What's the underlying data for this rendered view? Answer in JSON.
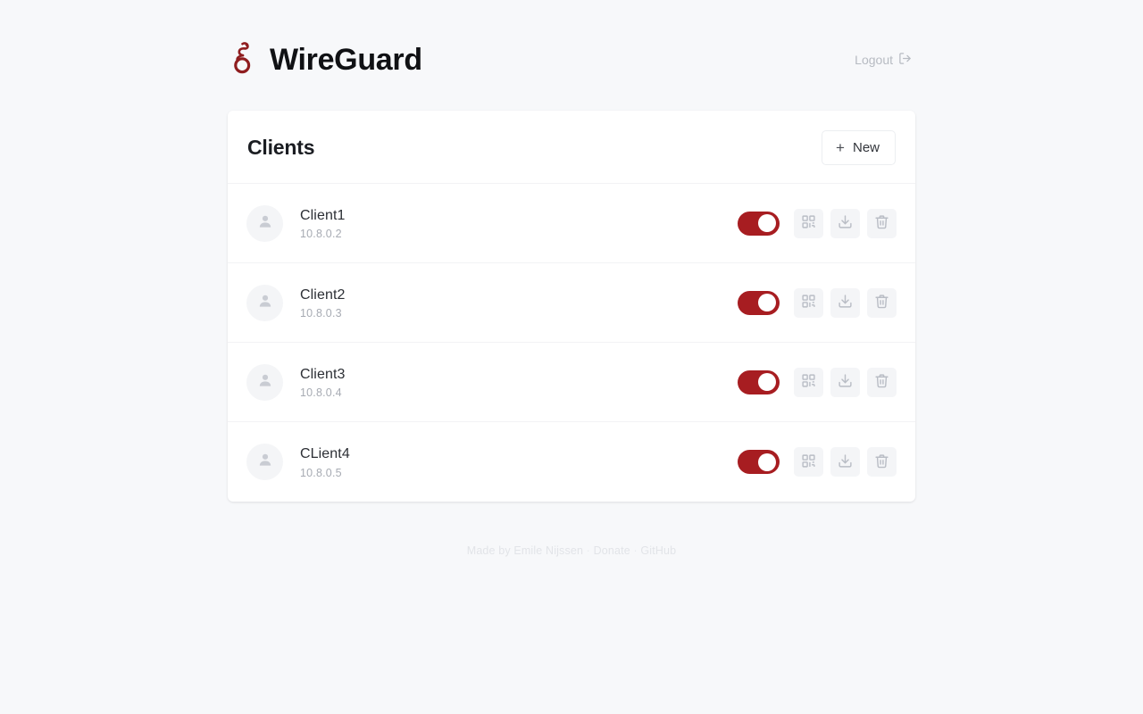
{
  "header": {
    "brand_title": "WireGuard",
    "logo_icon": "wireguard-dragon-logo",
    "logout_label": "Logout",
    "logout_icon": "logout-arrow-icon"
  },
  "card": {
    "title": "Clients",
    "new_button_label": "New",
    "new_button_plus": "+"
  },
  "clients": [
    {
      "name": "Client1",
      "ip": "10.8.0.2",
      "enabled": true,
      "avatar_icon": "user-avatar-icon",
      "qr_icon": "qr-code-icon",
      "download_icon": "download-icon",
      "delete_icon": "trash-icon"
    },
    {
      "name": "Client2",
      "ip": "10.8.0.3",
      "enabled": true,
      "avatar_icon": "user-avatar-icon",
      "qr_icon": "qr-code-icon",
      "download_icon": "download-icon",
      "delete_icon": "trash-icon"
    },
    {
      "name": "Client3",
      "ip": "10.8.0.4",
      "enabled": true,
      "avatar_icon": "user-avatar-icon",
      "qr_icon": "qr-code-icon",
      "download_icon": "download-icon",
      "delete_icon": "trash-icon"
    },
    {
      "name": "CLient4",
      "ip": "10.8.0.5",
      "enabled": true,
      "avatar_icon": "user-avatar-icon",
      "qr_icon": "qr-code-icon",
      "download_icon": "download-icon",
      "delete_icon": "trash-icon"
    }
  ],
  "footer": {
    "made_by": "Made by Emile Nijssen",
    "separator_1": "·",
    "donate": "Donate",
    "separator_2": "·",
    "github": "GitHub"
  },
  "colors": {
    "page_background": "#f7f8fa",
    "card_background": "#ffffff",
    "accent_red": "#a71d21",
    "title_text": "#1b1d22",
    "muted_text": "#a7abb3",
    "icon_button_background": "#f4f5f7",
    "footer_text": "#e2e4e8"
  }
}
